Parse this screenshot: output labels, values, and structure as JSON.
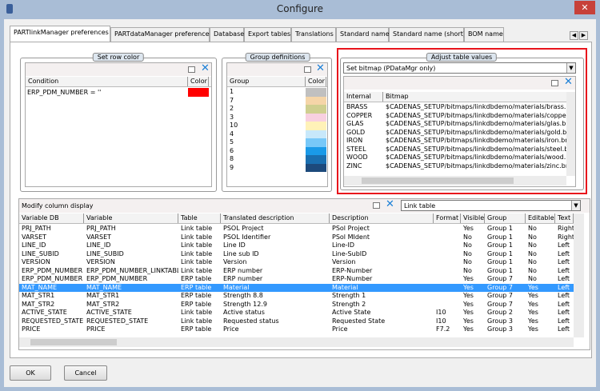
{
  "window": {
    "title": "Configure"
  },
  "tabs": [
    "PARTlinkManager preferences",
    "PARTdataManager preferences",
    "Database",
    "Export tables",
    "Translations",
    "Standard name",
    "Standard name (short)",
    "BOM name"
  ],
  "row_color": {
    "legend": "Set row color",
    "columns": [
      "Condition",
      "Color"
    ],
    "rows": [
      {
        "condition": "ERP_PDM_NUMBER = ''",
        "color": "#ff0000"
      }
    ]
  },
  "group_defs": {
    "legend": "Group definitions",
    "columns": [
      "Group",
      "Color"
    ],
    "rows": [
      {
        "group": "1",
        "color": "#c0c0c0"
      },
      {
        "group": "7",
        "color": "#f5d5a8"
      },
      {
        "group": "2",
        "color": "#cfcf90"
      },
      {
        "group": "3",
        "color": "#f8d0e0"
      },
      {
        "group": "10",
        "color": "#fff2b8"
      },
      {
        "group": "4",
        "color": "#c8e8fa"
      },
      {
        "group": "5",
        "color": "#78c8f8"
      },
      {
        "group": "6",
        "color": "#1a9ae8"
      },
      {
        "group": "8",
        "color": "#1a6fb0"
      },
      {
        "group": "9",
        "color": "#1d4a7c"
      }
    ]
  },
  "adjust": {
    "legend": "Adjust table values",
    "mode": "Set bitmap (PDataMgr only)",
    "columns": [
      "Internal",
      "Bitmap"
    ],
    "rows": [
      [
        "BRASS",
        "$CADENAS_SETUP/bitmaps/linkdbdemo/materials/brass.bmp"
      ],
      [
        "COPPER",
        "$CADENAS_SETUP/bitmaps/linkdbdemo/materials/copper.bmp"
      ],
      [
        "GLAS",
        "$CADENAS_SETUP/bitmaps/linkdbdemo/materials/glas.bmp"
      ],
      [
        "GOLD",
        "$CADENAS_SETUP/bitmaps/linkdbdemo/materials/gold.bmp"
      ],
      [
        "IRON",
        "$CADENAS_SETUP/bitmaps/linkdbdemo/materials/iron.bmp"
      ],
      [
        "STEEL",
        "$CADENAS_SETUP/bitmaps/linkdbdemo/materials/steel.bmp"
      ],
      [
        "WOOD",
        "$CADENAS_SETUP/bitmaps/linkdbdemo/materials/wood.bmp"
      ],
      [
        "ZINC",
        "$CADENAS_SETUP/bitmaps/linkdbdemo/materials/zinc.bmp"
      ]
    ]
  },
  "columns_display": {
    "label": "Modify column display",
    "table_select": "Link table",
    "columns": [
      "Variable DB",
      "Variable",
      "Table",
      "Translated description",
      "Description",
      "Format",
      "Visible",
      "Group",
      "Editable",
      "Text"
    ],
    "rows": [
      [
        "PRJ_PATH",
        "PRJ_PATH",
        "Link table",
        "PSOL Project",
        "PSol Project",
        "",
        "Yes",
        "Group 1",
        "No",
        "Right"
      ],
      [
        "VARSET",
        "VARSET",
        "Link table",
        "PSOL Identifier",
        "PSol MIdent",
        "",
        "No",
        "Group 1",
        "No",
        "Right"
      ],
      [
        "LINE_ID",
        "LINE_ID",
        "Link table",
        "Line ID",
        "Line-ID",
        "",
        "No",
        "Group 1",
        "No",
        "Left"
      ],
      [
        "LINE_SUBID",
        "LINE_SUBID",
        "Link table",
        "Line sub ID",
        "Line-SubID",
        "",
        "No",
        "Group 1",
        "No",
        "Left"
      ],
      [
        "VERSION",
        "VERSION",
        "Link table",
        "Version",
        "Version",
        "",
        "No",
        "Group 1",
        "No",
        "Left"
      ],
      [
        "ERP_PDM_NUMBER",
        "ERP_PDM_NUMBER_LINKTABLE",
        "Link table",
        "ERP number",
        "ERP-Number",
        "",
        "No",
        "Group 1",
        "No",
        "Left"
      ],
      [
        "ERP_PDM_NUMBER",
        "ERP_PDM_NUMBER",
        "ERP table",
        "ERP number",
        "ERP-Number",
        "",
        "Yes",
        "Group 7",
        "No",
        "Left"
      ],
      [
        "MAT_NAME",
        "MAT_NAME",
        "ERP table",
        "Material",
        "Material",
        "",
        "Yes",
        "Group 7",
        "Yes",
        "Left"
      ],
      [
        "MAT_STR1",
        "MAT_STR1",
        "ERP table",
        "Strength 8.8",
        "Strength 1",
        "",
        "Yes",
        "Group 7",
        "Yes",
        "Left"
      ],
      [
        "MAT_STR2",
        "MAT_STR2",
        "ERP table",
        "Strength 12.9",
        "Strength 2",
        "",
        "Yes",
        "Group 7",
        "Yes",
        "Left"
      ],
      [
        "ACTIVE_STATE",
        "ACTIVE_STATE",
        "Link table",
        "Active status",
        "Active State",
        "I10",
        "Yes",
        "Group 2",
        "Yes",
        "Left"
      ],
      [
        "REQUESTED_STATE",
        "REQUESTED_STATE",
        "Link table",
        "Requested status",
        "Requested State",
        "I10",
        "Yes",
        "Group 3",
        "Yes",
        "Left"
      ],
      [
        "PRICE",
        "PRICE",
        "ERP table",
        "Price",
        "Price",
        "F7.2",
        "Yes",
        "Group 3",
        "Yes",
        "Left"
      ]
    ],
    "selected_row": 7
  },
  "buttons": {
    "ok": "OK",
    "cancel": "Cancel"
  },
  "colors": {
    "highlight_border": "#e8141c",
    "selection": "#3399ff"
  }
}
